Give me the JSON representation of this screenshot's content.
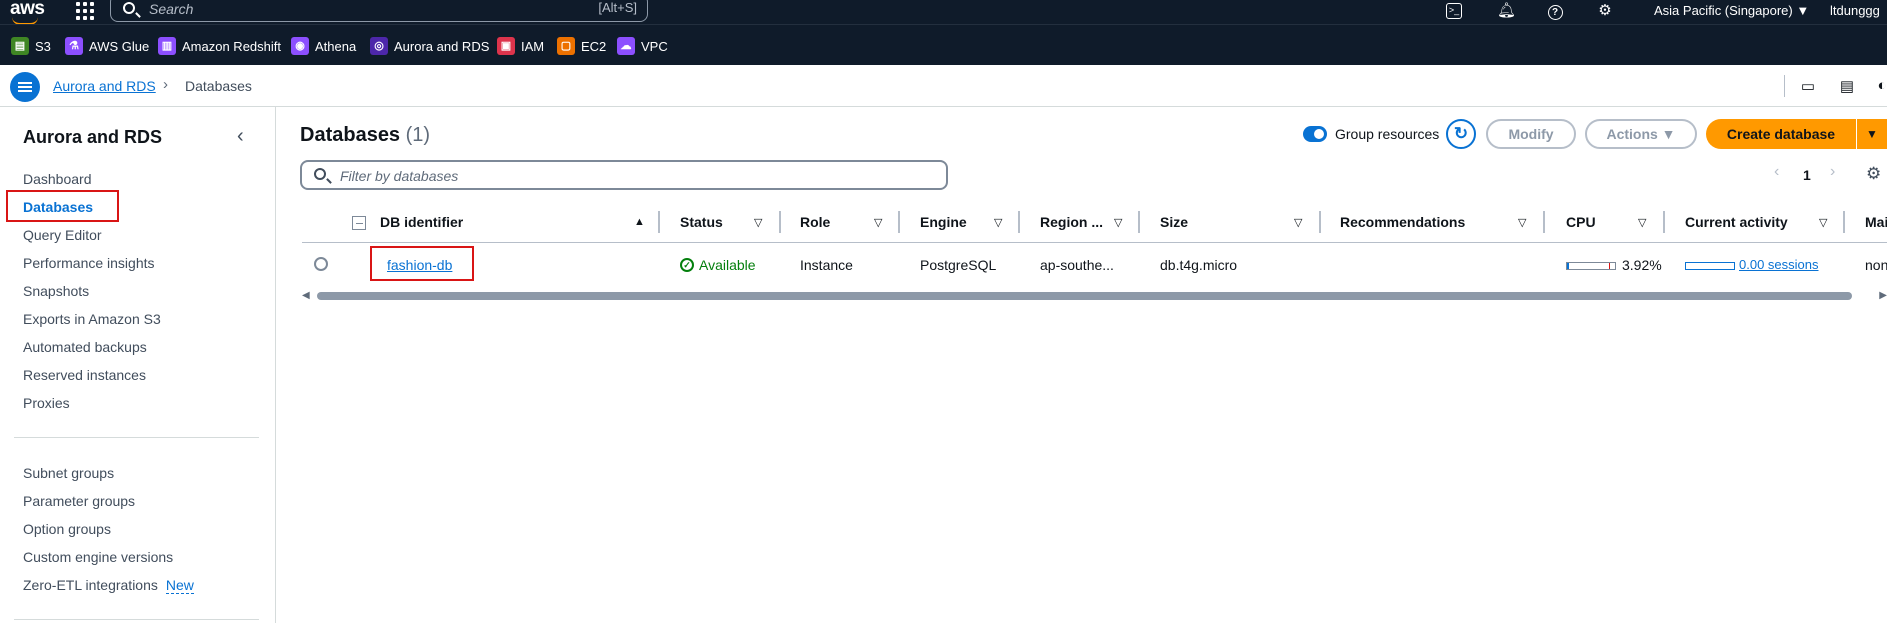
{
  "topbar": {
    "logo": "aws",
    "search_placeholder": "Search",
    "search_hint": "[Alt+S]",
    "region": "Asia Pacific (Singapore) ▼",
    "user": "ltdunggg",
    "icons": [
      "cloudshell-icon",
      "bell-icon",
      "help-icon",
      "settings-icon"
    ]
  },
  "favorites": [
    {
      "label": "S3",
      "color": "#3f8624"
    },
    {
      "label": "AWS Glue",
      "color": "#8c4fff"
    },
    {
      "label": "Amazon Redshift",
      "color": "#8c4fff"
    },
    {
      "label": "Athena",
      "color": "#8c4fff"
    },
    {
      "label": "Aurora and RDS",
      "color": "#4d27aa"
    },
    {
      "label": "IAM",
      "color": "#dd344c"
    },
    {
      "label": "EC2",
      "color": "#ed7100"
    },
    {
      "label": "VPC",
      "color": "#8c4fff"
    }
  ],
  "breadcrumb": {
    "parent": "Aurora and RDS",
    "separator": "›",
    "current": "Databases"
  },
  "sidebar": {
    "title": "Aurora and RDS",
    "close": "‹",
    "items": [
      {
        "label": "Dashboard"
      },
      {
        "label": "Databases"
      },
      {
        "label": "Query Editor"
      },
      {
        "label": "Performance insights"
      },
      {
        "label": "Snapshots"
      },
      {
        "label": "Exports in Amazon S3"
      },
      {
        "label": "Automated backups"
      },
      {
        "label": "Reserved instances"
      },
      {
        "label": "Proxies"
      }
    ],
    "items2": [
      {
        "label": "Subnet groups"
      },
      {
        "label": "Parameter groups"
      },
      {
        "label": "Option groups"
      },
      {
        "label": "Custom engine versions"
      },
      {
        "label": "Zero-ETL integrations"
      }
    ],
    "new_badge": "New"
  },
  "main": {
    "title": "Databases",
    "count": "(1)",
    "group_resources": "Group resources",
    "refresh": "↻",
    "modify": "Modify",
    "actions": "Actions ▼",
    "create": "Create database",
    "create_caret": "▼",
    "filter_placeholder": "Filter by databases",
    "page": "1",
    "prev": "‹",
    "next": "›",
    "gear": "⚙"
  },
  "table": {
    "headers": [
      "DB identifier",
      "Status",
      "Role",
      "Engine",
      "Region ...",
      "Size",
      "Recommendations",
      "CPU",
      "Current activity",
      "Mai"
    ],
    "sort_asc": "▲",
    "filter_caret": "▽",
    "row": {
      "identifier": "fashion-db",
      "status": "Available",
      "role": "Instance",
      "engine": "PostgreSQL",
      "region": "ap-southe...",
      "size": "db.t4g.micro",
      "recommendations": "",
      "cpu": "3.92%",
      "cpu_fraction": 0.0392,
      "activity": "0.00 sessions",
      "maintenance": "non"
    }
  },
  "scroll": {
    "left": "◀",
    "right": "▶"
  }
}
